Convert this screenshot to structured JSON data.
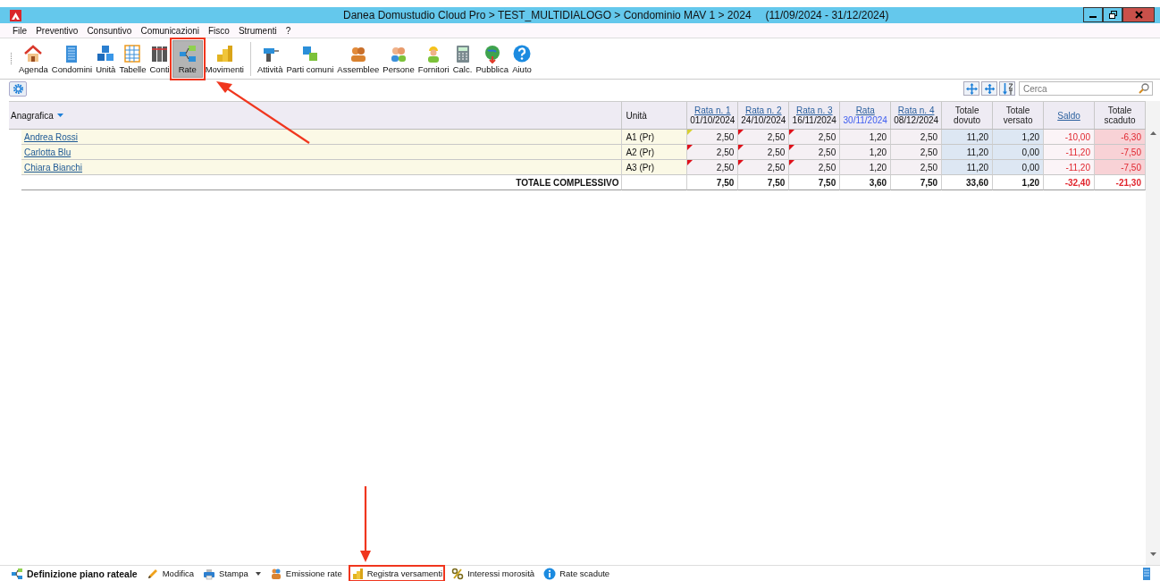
{
  "window": {
    "title": "Danea Domustudio Cloud Pro > TEST_MULTIDIALOGO > Condominio MAV 1 > 2024",
    "period": "(11/09/2024 - 31/12/2024)"
  },
  "menu": [
    "File",
    "Preventivo",
    "Consuntivo",
    "Comunicazioni",
    "Fisco",
    "Strumenti",
    "?"
  ],
  "toolbar_groups": [
    [
      {
        "label": "Agenda",
        "selected": false,
        "highlighted": false
      },
      {
        "label": "Condomini",
        "selected": false,
        "highlighted": false
      },
      {
        "label": "Unità",
        "selected": false,
        "highlighted": false
      },
      {
        "label": "Tabelle",
        "selected": false,
        "highlighted": false
      },
      {
        "label": "Conti",
        "selected": false,
        "highlighted": false
      },
      {
        "label": "Rate",
        "selected": true,
        "highlighted": true
      },
      {
        "label": "Movimenti",
        "selected": false,
        "highlighted": false
      }
    ],
    [
      {
        "label": "Attività",
        "selected": false,
        "highlighted": false
      },
      {
        "label": "Parti comuni",
        "selected": false,
        "highlighted": false
      },
      {
        "label": "Assemblee",
        "selected": false,
        "highlighted": false
      },
      {
        "label": "Persone",
        "selected": false,
        "highlighted": false
      },
      {
        "label": "Fornitori",
        "selected": false,
        "highlighted": false
      },
      {
        "label": "Calc.",
        "selected": false,
        "highlighted": false
      },
      {
        "label": "Pubblica",
        "selected": false,
        "highlighted": false
      },
      {
        "label": "Aiuto",
        "selected": false,
        "highlighted": false
      }
    ]
  ],
  "search": {
    "placeholder": "Cerca"
  },
  "table": {
    "name_header": "Anagrafica",
    "unit_header": "Unità",
    "columns": [
      {
        "label": "Rata n. 1",
        "date": "01/10/2024",
        "link": true,
        "date_highlight": false,
        "kind": "rate"
      },
      {
        "label": "Rata n. 2",
        "date": "24/10/2024",
        "link": true,
        "date_highlight": false,
        "kind": "rate"
      },
      {
        "label": "Rata n. 3",
        "date": "16/11/2024",
        "link": true,
        "date_highlight": false,
        "kind": "rate"
      },
      {
        "label": "Rata",
        "date": "30/11/2024",
        "link": true,
        "date_highlight": true,
        "kind": "rate"
      },
      {
        "label": "Rata n. 4",
        "date": "08/12/2024",
        "link": true,
        "date_highlight": false,
        "kind": "rate"
      },
      {
        "label": "Totale dovuto",
        "link": false,
        "kind": "sum"
      },
      {
        "label": "Totale versato",
        "link": false,
        "kind": "sum"
      },
      {
        "label": "Saldo",
        "link": true,
        "kind": "balance"
      },
      {
        "label": "Totale scaduto",
        "link": false,
        "kind": "overdue"
      }
    ],
    "rows": [
      {
        "name": "Andrea Rossi",
        "unit": "A1 (Pr)",
        "cells": [
          {
            "value": "2,50",
            "flag": {
              "color": "#d8d030"
            }
          },
          {
            "value": "2,50",
            "flag": {
              "color": "#e0101a"
            }
          },
          {
            "value": "2,50",
            "flag": {
              "color": "#e0101a"
            }
          },
          {
            "value": "1,20"
          },
          {
            "value": "2,50"
          },
          {
            "value": "11,20"
          },
          {
            "value": "1,20"
          },
          {
            "value": "-10,00"
          },
          {
            "value": "-6,30"
          }
        ]
      },
      {
        "name": "Carlotta Blu",
        "unit": "A2 (Pr)",
        "cells": [
          {
            "value": "2,50",
            "flag": {
              "color": "#e0101a"
            }
          },
          {
            "value": "2,50",
            "flag": {
              "color": "#e0101a"
            }
          },
          {
            "value": "2,50",
            "flag": {
              "color": "#e0101a"
            }
          },
          {
            "value": "1,20"
          },
          {
            "value": "2,50"
          },
          {
            "value": "11,20"
          },
          {
            "value": "0,00"
          },
          {
            "value": "-11,20"
          },
          {
            "value": "-7,50"
          }
        ]
      },
      {
        "name": "Chiara Bianchi",
        "unit": "A3 (Pr)",
        "cells": [
          {
            "value": "2,50",
            "flag": {
              "color": "#e0101a"
            }
          },
          {
            "value": "2,50",
            "flag": {
              "color": "#e0101a"
            }
          },
          {
            "value": "2,50",
            "flag": {
              "color": "#e0101a"
            }
          },
          {
            "value": "1,20"
          },
          {
            "value": "2,50"
          },
          {
            "value": "11,20"
          },
          {
            "value": "0,00"
          },
          {
            "value": "-11,20"
          },
          {
            "value": "-7,50"
          }
        ]
      }
    ],
    "total": {
      "label": "TOTALE COMPLESSIVO",
      "values": [
        "7,50",
        "7,50",
        "7,50",
        "3,60",
        "7,50",
        "33,60",
        "1,20",
        "-32,40",
        "-21,30"
      ]
    }
  },
  "footer_actions": [
    {
      "label": "Definizione piano rateale",
      "bold": true,
      "dropdown": false,
      "highlighted": false
    },
    {
      "label": "Modifica",
      "bold": false,
      "dropdown": false,
      "highlighted": false
    },
    {
      "label": "Stampa",
      "bold": false,
      "dropdown": true,
      "highlighted": false
    },
    {
      "label": "Emissione rate",
      "bold": false,
      "dropdown": false,
      "highlighted": false
    },
    {
      "label": "Registra versamenti",
      "bold": false,
      "dropdown": false,
      "highlighted": true
    },
    {
      "label": "Interessi morosità",
      "bold": false,
      "dropdown": false,
      "highlighted": false
    },
    {
      "label": "Rate scadute",
      "bold": false,
      "dropdown": false,
      "highlighted": false
    }
  ]
}
